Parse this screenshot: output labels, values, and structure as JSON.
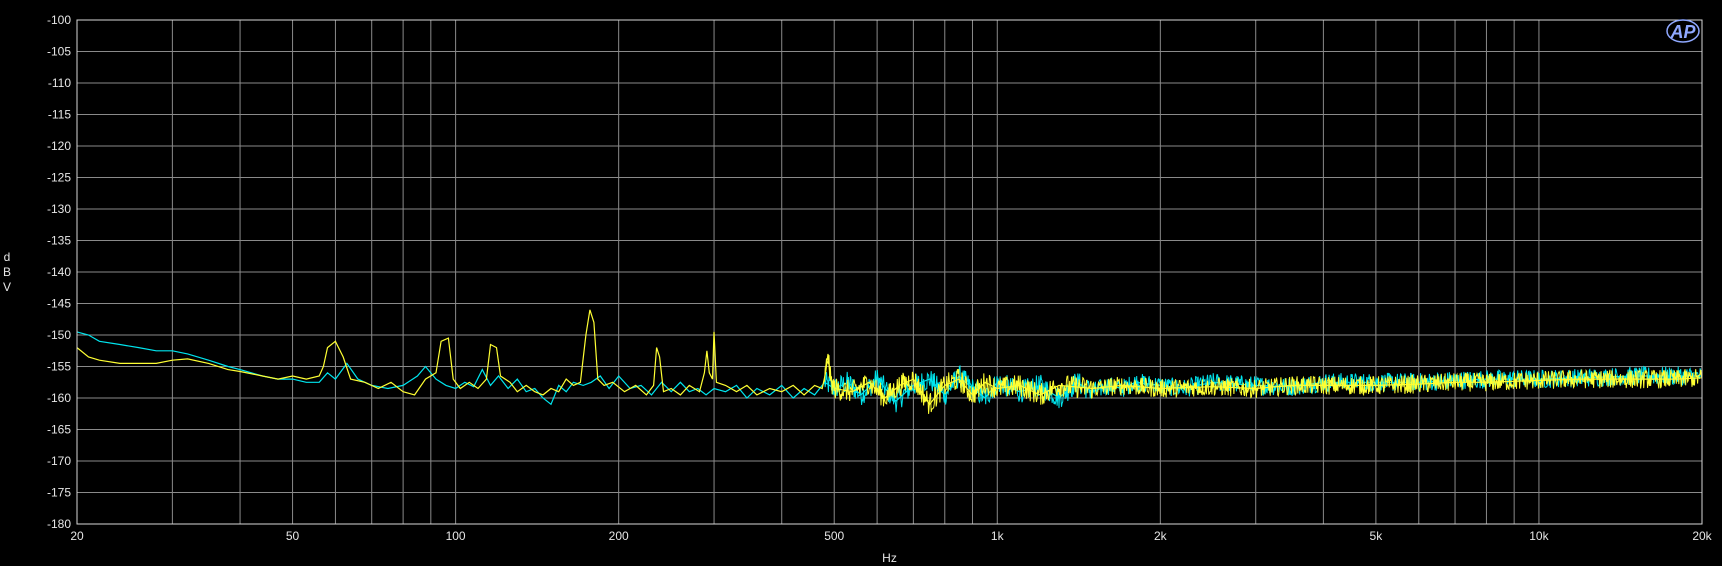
{
  "chart_data": {
    "type": "line",
    "title": "",
    "xlabel": "Hz",
    "ylabel": "dBV",
    "ylabel_letters": [
      "d",
      "B",
      "V"
    ],
    "x_scale": "log",
    "xlim": [
      20,
      20000
    ],
    "ylim": [
      -180,
      -100
    ],
    "grid": true,
    "x_ticks": [
      {
        "v": 20,
        "label": "20"
      },
      {
        "v": 50,
        "label": "50"
      },
      {
        "v": 100,
        "label": "100"
      },
      {
        "v": 200,
        "label": "200"
      },
      {
        "v": 500,
        "label": "500"
      },
      {
        "v": 1000,
        "label": "1k"
      },
      {
        "v": 2000,
        "label": "2k"
      },
      {
        "v": 5000,
        "label": "5k"
      },
      {
        "v": 10000,
        "label": "10k"
      },
      {
        "v": 20000,
        "label": "20k"
      }
    ],
    "y_ticks": [
      {
        "v": -100,
        "label": "-100"
      },
      {
        "v": -105,
        "label": "-105"
      },
      {
        "v": -110,
        "label": "-110"
      },
      {
        "v": -115,
        "label": "-115"
      },
      {
        "v": -120,
        "label": "-120"
      },
      {
        "v": -125,
        "label": "-125"
      },
      {
        "v": -130,
        "label": "-130"
      },
      {
        "v": -135,
        "label": "-135"
      },
      {
        "v": -140,
        "label": "-140"
      },
      {
        "v": -145,
        "label": "-145"
      },
      {
        "v": -150,
        "label": "-150"
      },
      {
        "v": -155,
        "label": "-155"
      },
      {
        "v": -160,
        "label": "-160"
      },
      {
        "v": -165,
        "label": "-165"
      },
      {
        "v": -170,
        "label": "-170"
      },
      {
        "v": -175,
        "label": "-175"
      },
      {
        "v": -180,
        "label": "-180"
      }
    ],
    "logo": "AP",
    "series": [
      {
        "color": "#00e5ee",
        "points": [
          [
            20,
            -149.5
          ],
          [
            21,
            -150
          ],
          [
            22,
            -151
          ],
          [
            24,
            -151.5
          ],
          [
            26,
            -152
          ],
          [
            28,
            -152.5
          ],
          [
            30,
            -152.5
          ],
          [
            32,
            -153
          ],
          [
            35,
            -154
          ],
          [
            38,
            -155
          ],
          [
            40,
            -155.5
          ],
          [
            44,
            -156.5
          ],
          [
            47,
            -157
          ],
          [
            50,
            -157
          ],
          [
            53,
            -157.5
          ],
          [
            56,
            -157.5
          ],
          [
            58,
            -156
          ],
          [
            60,
            -157
          ],
          [
            63,
            -154.5
          ],
          [
            66,
            -157
          ],
          [
            70,
            -158
          ],
          [
            75,
            -158.5
          ],
          [
            80,
            -158
          ],
          [
            85,
            -156.5
          ],
          [
            88,
            -155
          ],
          [
            92,
            -157
          ],
          [
            96,
            -158
          ],
          [
            100,
            -158.5
          ],
          [
            104,
            -157.5
          ],
          [
            108,
            -158.2
          ],
          [
            112,
            -155.5
          ],
          [
            116,
            -158
          ],
          [
            120,
            -156.5
          ],
          [
            125,
            -158.5
          ],
          [
            130,
            -157
          ],
          [
            135,
            -159
          ],
          [
            140,
            -158.5
          ],
          [
            145,
            -160
          ],
          [
            150,
            -161
          ],
          [
            155,
            -158
          ],
          [
            160,
            -159
          ],
          [
            165,
            -157.5
          ],
          [
            172,
            -158
          ],
          [
            178,
            -157.5
          ],
          [
            185,
            -156.5
          ],
          [
            192,
            -158.5
          ],
          [
            200,
            -156.5
          ],
          [
            210,
            -158.5
          ],
          [
            220,
            -158
          ],
          [
            230,
            -159.5
          ],
          [
            240,
            -157.5
          ],
          [
            250,
            -159
          ],
          [
            260,
            -157.5
          ],
          [
            270,
            -159
          ],
          [
            280,
            -158.5
          ],
          [
            290,
            -159.5
          ],
          [
            300,
            -158.5
          ],
          [
            315,
            -159
          ],
          [
            330,
            -158
          ],
          [
            345,
            -160
          ],
          [
            360,
            -158.5
          ],
          [
            380,
            -159.5
          ],
          [
            400,
            -158
          ],
          [
            420,
            -160
          ],
          [
            440,
            -158.5
          ],
          [
            460,
            -159.5
          ],
          [
            480,
            -157.5
          ],
          [
            500,
            -158.5
          ],
          [
            530,
            -157.5
          ],
          [
            560,
            -159.5
          ],
          [
            600,
            -157
          ],
          [
            650,
            -160.5
          ],
          [
            700,
            -158
          ],
          [
            750,
            -157
          ],
          [
            800,
            -159.5
          ],
          [
            850,
            -156.5
          ],
          [
            900,
            -158.5
          ],
          [
            950,
            -160
          ],
          [
            1000,
            -157.5
          ],
          [
            1100,
            -159
          ],
          [
            1200,
            -158
          ],
          [
            1300,
            -160
          ],
          [
            1400,
            -157.5
          ],
          [
            1500,
            -159
          ],
          [
            1600,
            -158
          ],
          [
            1700,
            -158.5
          ],
          [
            1800,
            -157.5
          ],
          [
            2000,
            -158
          ],
          [
            2200,
            -158.5
          ],
          [
            2500,
            -157.5
          ],
          [
            3000,
            -158
          ],
          [
            3500,
            -158.2
          ],
          [
            4000,
            -157.5
          ],
          [
            5000,
            -157.5
          ],
          [
            6000,
            -157.5
          ],
          [
            7000,
            -157.2
          ],
          [
            8000,
            -157
          ],
          [
            10000,
            -157
          ],
          [
            12000,
            -156.8
          ],
          [
            15000,
            -156.5
          ],
          [
            18000,
            -156.5
          ],
          [
            20000,
            -156.5
          ]
        ]
      },
      {
        "color": "#ffff33",
        "points": [
          [
            20,
            -152
          ],
          [
            21,
            -153.5
          ],
          [
            22,
            -154
          ],
          [
            24,
            -154.5
          ],
          [
            26,
            -154.5
          ],
          [
            28,
            -154.5
          ],
          [
            30,
            -154
          ],
          [
            32,
            -153.8
          ],
          [
            35,
            -154.5
          ],
          [
            38,
            -155.5
          ],
          [
            40,
            -155.8
          ],
          [
            44,
            -156.5
          ],
          [
            47,
            -157
          ],
          [
            50,
            -156.5
          ],
          [
            53,
            -157
          ],
          [
            56,
            -156.5
          ],
          [
            57,
            -155
          ],
          [
            58,
            -152
          ],
          [
            60,
            -151
          ],
          [
            62,
            -153.5
          ],
          [
            64,
            -157
          ],
          [
            68,
            -157.5
          ],
          [
            72,
            -158.5
          ],
          [
            76,
            -157.5
          ],
          [
            80,
            -159
          ],
          [
            84,
            -159.5
          ],
          [
            88,
            -157
          ],
          [
            92,
            -156
          ],
          [
            94,
            -151
          ],
          [
            97,
            -150.5
          ],
          [
            99,
            -157
          ],
          [
            102,
            -158.5
          ],
          [
            106,
            -157.5
          ],
          [
            110,
            -158.5
          ],
          [
            114,
            -157
          ],
          [
            116,
            -151.5
          ],
          [
            119,
            -152
          ],
          [
            121,
            -156.5
          ],
          [
            126,
            -157.5
          ],
          [
            130,
            -159
          ],
          [
            135,
            -158
          ],
          [
            140,
            -159
          ],
          [
            145,
            -159.5
          ],
          [
            150,
            -158.5
          ],
          [
            155,
            -159
          ],
          [
            160,
            -157
          ],
          [
            165,
            -158
          ],
          [
            170,
            -157.5
          ],
          [
            174,
            -150
          ],
          [
            177,
            -146
          ],
          [
            180,
            -148
          ],
          [
            183,
            -157
          ],
          [
            188,
            -158
          ],
          [
            195,
            -157.5
          ],
          [
            205,
            -159
          ],
          [
            215,
            -158
          ],
          [
            225,
            -159.5
          ],
          [
            232,
            -158
          ],
          [
            235,
            -152
          ],
          [
            238,
            -153.5
          ],
          [
            242,
            -159
          ],
          [
            250,
            -158.5
          ],
          [
            260,
            -159.5
          ],
          [
            270,
            -158
          ],
          [
            282,
            -159
          ],
          [
            288,
            -156
          ],
          [
            291,
            -152.5
          ],
          [
            294,
            -156
          ],
          [
            298,
            -157
          ],
          [
            300,
            -149.5
          ],
          [
            303,
            -157.5
          ],
          [
            315,
            -158
          ],
          [
            330,
            -159
          ],
          [
            345,
            -158
          ],
          [
            360,
            -159.5
          ],
          [
            380,
            -158.5
          ],
          [
            400,
            -159
          ],
          [
            420,
            -158
          ],
          [
            440,
            -159.5
          ],
          [
            460,
            -158
          ],
          [
            475,
            -158.5
          ],
          [
            482,
            -156
          ],
          [
            487,
            -153
          ],
          [
            492,
            -157
          ],
          [
            500,
            -158.5
          ],
          [
            540,
            -159
          ],
          [
            580,
            -157.5
          ],
          [
            620,
            -160
          ],
          [
            660,
            -158
          ],
          [
            700,
            -157
          ],
          [
            750,
            -161
          ],
          [
            800,
            -158
          ],
          [
            850,
            -157
          ],
          [
            900,
            -159.5
          ],
          [
            950,
            -157.5
          ],
          [
            1000,
            -158.5
          ],
          [
            1100,
            -158
          ],
          [
            1200,
            -159.5
          ],
          [
            1300,
            -158
          ],
          [
            1500,
            -158.5
          ],
          [
            1700,
            -158
          ],
          [
            2000,
            -158.5
          ],
          [
            2500,
            -158.2
          ],
          [
            3000,
            -158.5
          ],
          [
            3500,
            -158
          ],
          [
            4000,
            -158
          ],
          [
            5000,
            -158
          ],
          [
            6000,
            -157.8
          ],
          [
            7000,
            -157.5
          ],
          [
            8000,
            -157.5
          ],
          [
            10000,
            -157.2
          ],
          [
            12000,
            -157
          ],
          [
            15000,
            -157
          ],
          [
            18000,
            -157
          ],
          [
            20000,
            -156.8
          ]
        ]
      }
    ]
  }
}
